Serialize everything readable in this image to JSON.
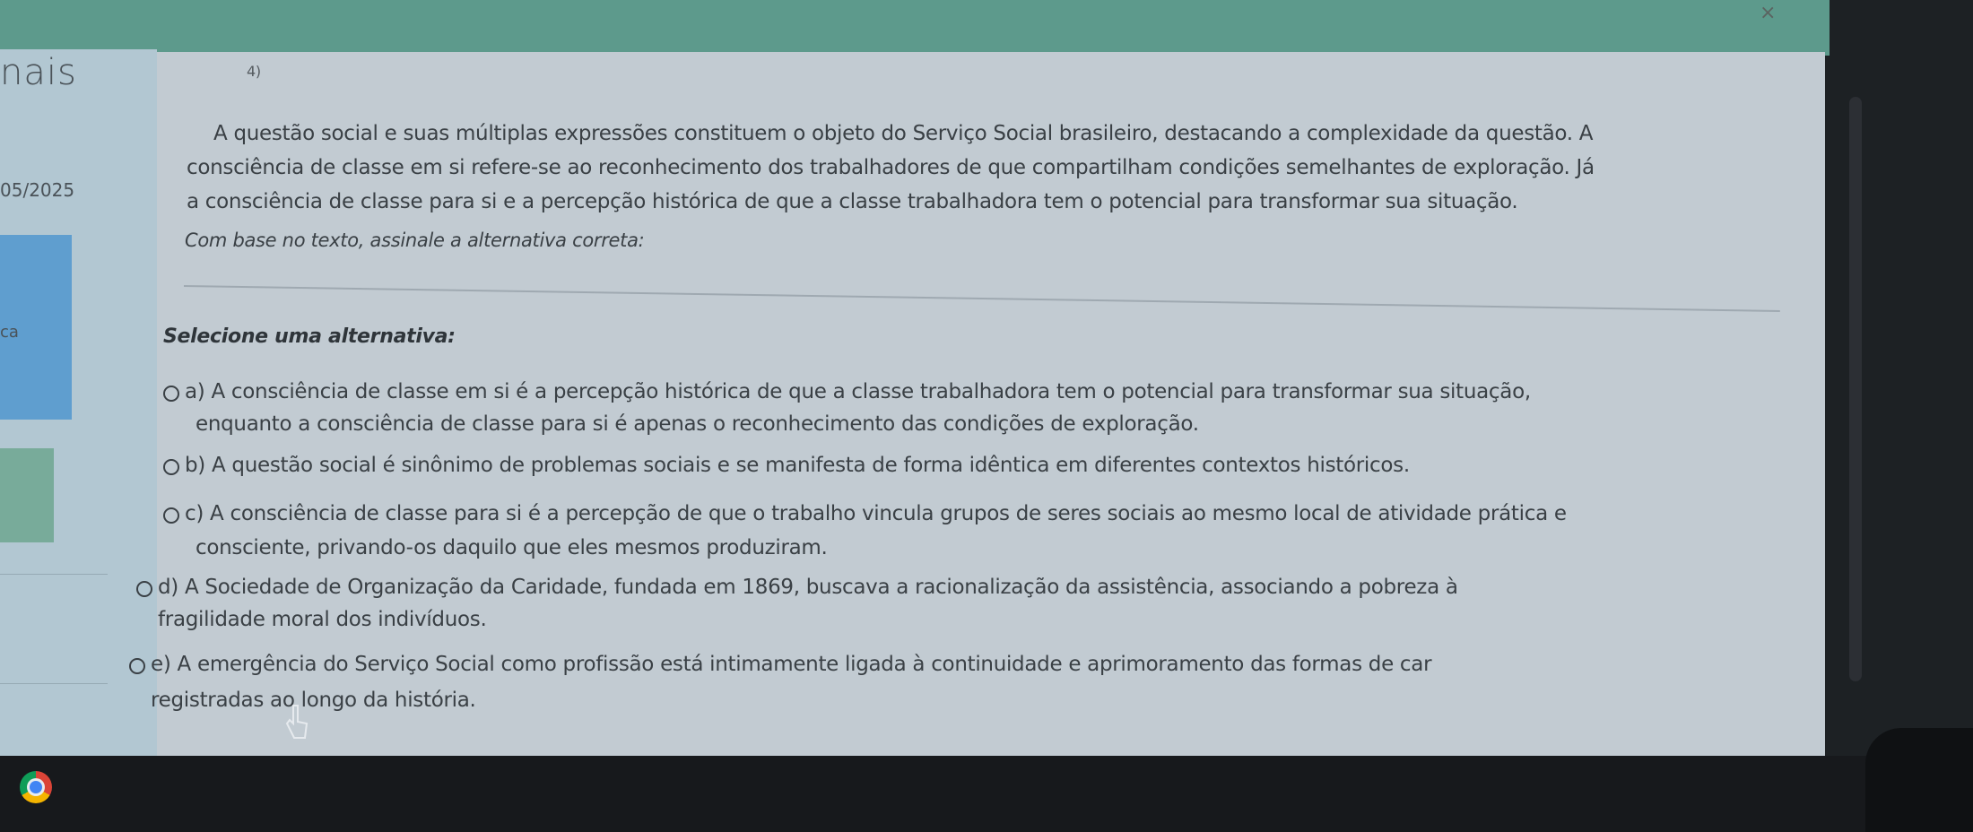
{
  "window": {
    "close_label": "×"
  },
  "sidebar": {
    "title_fragment": "nais",
    "date_fragment": "05/2025",
    "item_fragment": "ca"
  },
  "question": {
    "number": "4)",
    "paragraph_lines": [
      "A questão social e suas múltiplas expressões constituem o objeto do Serviço Social brasileiro, destacando a complexidade da questão. A",
      "consciência de classe em si refere-se ao reconhecimento dos trabalhadores de que compartilham condições semelhantes de exploração. Já",
      "a consciência de classe para si e a percepção histórica de que a classe trabalhadora tem o potencial para transformar sua situação."
    ],
    "prompt": "Com base no texto, assinale a alternativa correta:",
    "select_label": "Selecione uma alternativa:"
  },
  "options": [
    {
      "lines": [
        "a) A consciência de classe em si é a percepção histórica de que a classe trabalhadora tem o potencial para transformar sua situação,",
        "enquanto a consciência de classe para si é apenas o reconhecimento das condições de exploração."
      ]
    },
    {
      "lines": [
        "b) A questão social é sinônimo de problemas sociais e se manifesta de forma idêntica em diferentes contextos históricos."
      ]
    },
    {
      "lines": [
        "c) A consciência de classe para si é a percepção de que o trabalho vincula grupos de seres sociais ao mesmo local de atividade prática e",
        "consciente, privando-os daquilo que eles mesmos produziram."
      ]
    },
    {
      "lines": [
        "d) A Sociedade de Organização da Caridade, fundada em 1869, buscava a racionalização da assistência, associando a pobreza à",
        "fragilidade moral dos indivíduos."
      ]
    },
    {
      "lines": [
        "e) A emergência do Serviço Social como profissão está intimamente ligada à continuidade e aprimoramento das formas de car",
        "registradas ao longo da história."
      ]
    }
  ]
}
